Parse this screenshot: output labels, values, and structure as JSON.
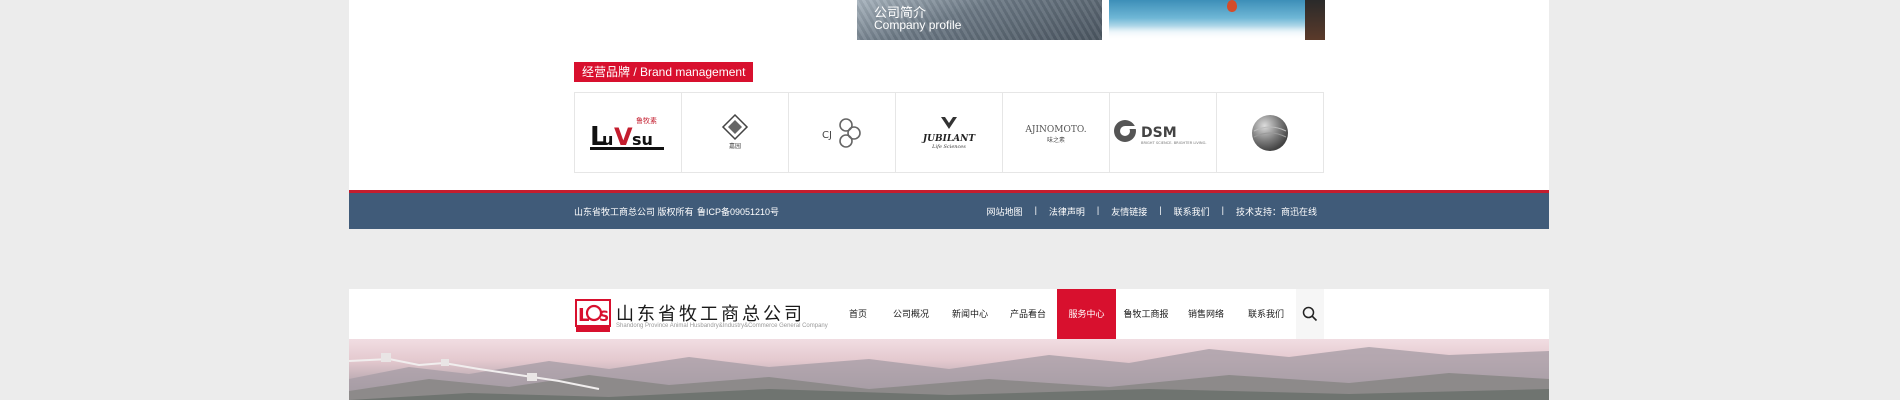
{
  "profile": {
    "title_cn": "公司简介",
    "title_en": "Company profile"
  },
  "brand_section": {
    "label": "经营品牌 / Brand management"
  },
  "brands": [
    {
      "name": "LuVsu",
      "cn": "鲁牧素"
    },
    {
      "name": "gucheng",
      "cn": "嘉园"
    },
    {
      "name": "CJ"
    },
    {
      "name": "JUBILANT",
      "sub": "Life Sciences"
    },
    {
      "name": "AJINOMOTO.",
      "cn": "味之素"
    },
    {
      "name": "DSM",
      "sub": "BRIGHT SCIENCE. BRIGHTER LIVING."
    },
    {
      "name": "globe"
    }
  ],
  "footer": {
    "copyright": "山东省牧工商总公司 版权所有",
    "icp": "鲁ICP备09051210号",
    "links": [
      "网站地图",
      "法律声明",
      "友情链接",
      "联系我们",
      "技术支持：商迅在线"
    ],
    "separator": "|"
  },
  "header": {
    "company_cn": "山东省牧工商总公司",
    "company_en": "Shandong Province Animal Husbandry&Industry&Commerce General Company",
    "nav": [
      {
        "label": "首页",
        "active": false
      },
      {
        "label": "公司概况",
        "active": false
      },
      {
        "label": "新闻中心",
        "active": false
      },
      {
        "label": "产品看台",
        "active": false
      },
      {
        "label": "服务中心",
        "active": true
      },
      {
        "label": "鲁牧工商报",
        "active": false
      },
      {
        "label": "销售网络",
        "active": false
      },
      {
        "label": "联系我们",
        "active": false
      }
    ]
  },
  "colors": {
    "accent": "#d8102e",
    "footer_bg": "#405b79",
    "footer_border": "#c41d2e"
  },
  "icons": {
    "search": "search-icon"
  }
}
